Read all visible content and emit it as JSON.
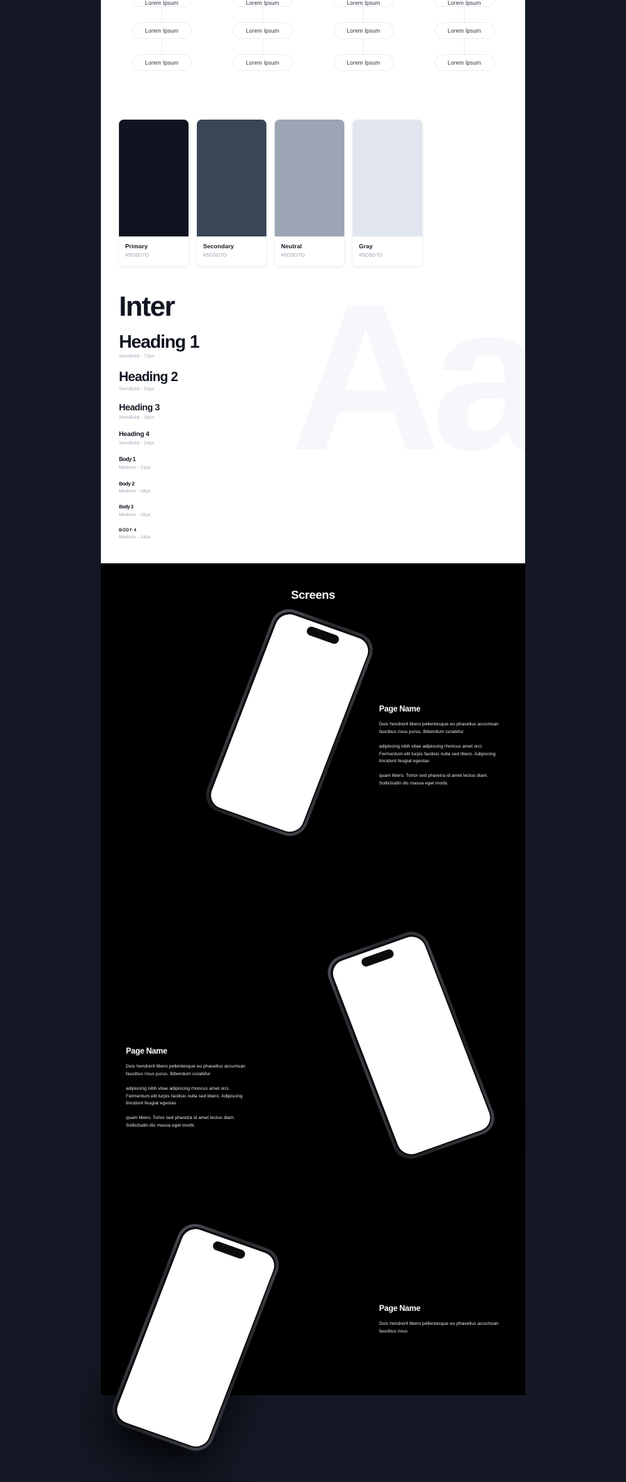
{
  "theme": {
    "page_background": "#131824",
    "sheet_background": "#FFFFFF",
    "screens_background": "#000000"
  },
  "sitemap": {
    "columns": [
      {
        "nodes": [
          "Lorem Ipsum",
          "Lorem Ipsum",
          "Lorem Ipsum"
        ]
      },
      {
        "nodes": [
          "Lorem Ipsum",
          "Lorem Ipsum",
          "Lorem Ipsum"
        ]
      },
      {
        "nodes": [
          "Lorem Ipsum",
          "Lorem Ipsum",
          "Lorem Ipsum"
        ]
      },
      {
        "nodes": [
          "Lorem Ipsum",
          "Lorem Ipsum",
          "Lorem Ipsum"
        ]
      }
    ]
  },
  "palette": {
    "swatches": [
      {
        "name": "Primary",
        "hex_label": "#5D5D7D",
        "color": "#0F1420"
      },
      {
        "name": "Secondary",
        "hex_label": "#5D5D7D",
        "color": "#3A4657"
      },
      {
        "name": "Neutral",
        "hex_label": "#5D5D7D",
        "color": "#9CA5B4"
      },
      {
        "name": "Gray",
        "hex_label": "#5D5D7D",
        "color": "#E1E6EE"
      }
    ]
  },
  "typography": {
    "font_name": "Inter",
    "watermark": "Aa",
    "scale": [
      {
        "sample": "Heading 1",
        "spec": "SemiBold - 72px"
      },
      {
        "sample": "Heading 2",
        "spec": "SemiBold - 52px"
      },
      {
        "sample": "Heading 3",
        "spec": "SemiBold - 36px"
      },
      {
        "sample": "Heading 4",
        "spec": "SemiBold - 24px"
      },
      {
        "sample": "Body 1",
        "spec": "Medium - 21px"
      },
      {
        "sample": "Body 2",
        "spec": "Medium - 18px"
      },
      {
        "sample": "Body 3",
        "spec": "Medium - 16px"
      },
      {
        "sample": "Body 4",
        "spec": "Medium - 14px"
      }
    ]
  },
  "screens": {
    "title": "Screens",
    "items": [
      {
        "title": "Page Name",
        "paragraphs": [
          "Duis hendrerit libero pellentesque eu phasellus accumsan faucibus risus purus. Bibendum curabitur",
          "adipiscing nibh vitae adipiscing rhoncus amet orci. Fermentum elit turpis facilisis nulla sed libero. Adipiscing tincidunt feugiat egestas",
          "quam libero. Tortor sed pharetra id amet lectus diam. Sollicitudin dis massa eget morbi."
        ]
      },
      {
        "title": "Page Name",
        "paragraphs": [
          "Duis hendrerit libero pellentesque eu phasellus accumsan faucibus risus purus. Bibendum curabitur",
          "adipiscing nibh vitae adipiscing rhoncus amet orci. Fermentum elit turpis facilisis nulla sed libero. Adipiscing tincidunt feugiat egestas",
          "quam libero. Tortor sed pharetra id amet lectus diam. Sollicitudin dis massa eget morbi."
        ]
      },
      {
        "title": "Page Name",
        "paragraphs": [
          "Duis hendrerit libero pellentesque eu phasellus accumsan faucibus risus"
        ]
      }
    ]
  }
}
